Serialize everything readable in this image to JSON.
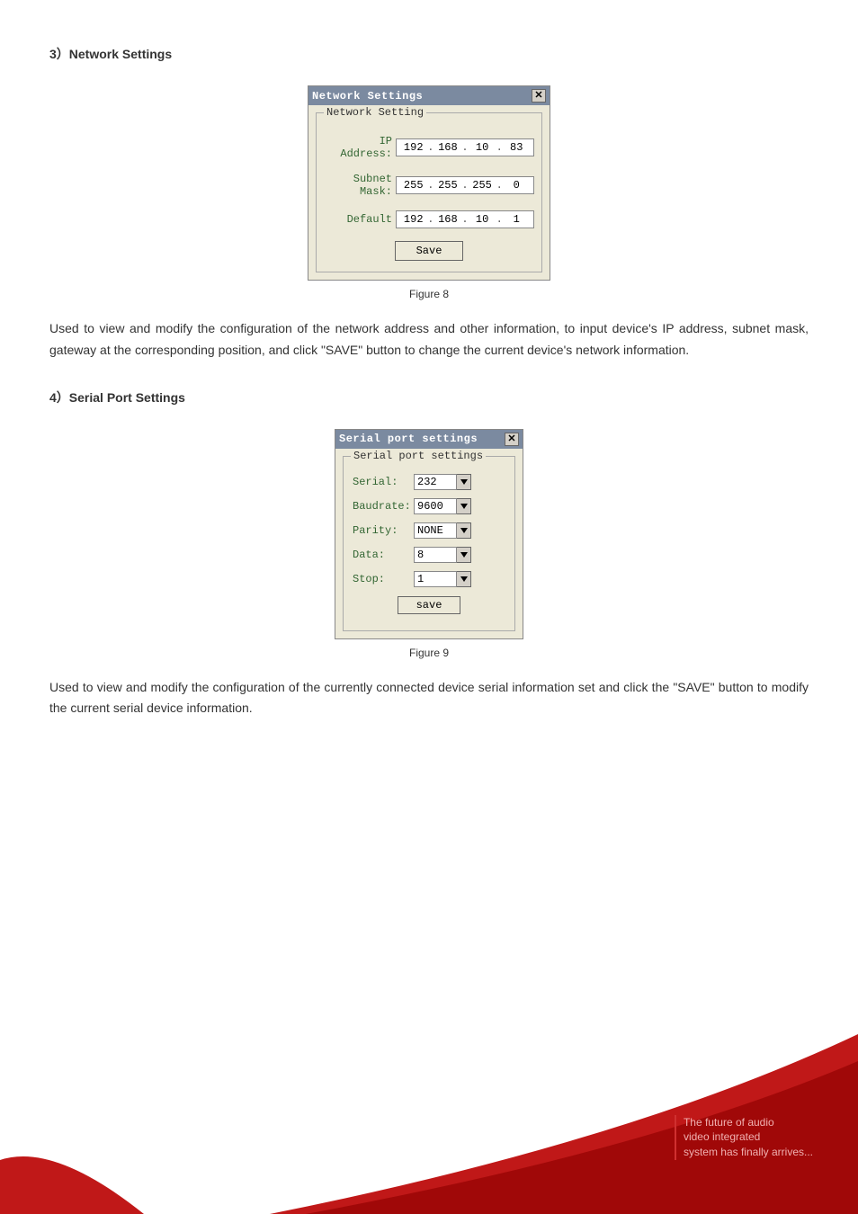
{
  "section3": {
    "title": "3）Network Settings"
  },
  "netDialog": {
    "title": "Network Settings",
    "legend": "Network Setting",
    "ip_label": "IP Address:",
    "ip": [
      "192",
      "168",
      "10",
      "83"
    ],
    "mask_label": "Subnet Mask:",
    "mask": [
      "255",
      "255",
      "255",
      "0"
    ],
    "gw_label": "Default",
    "gw": [
      "192",
      "168",
      "10",
      "1"
    ],
    "save_label": "Save"
  },
  "caption1": "Figure 8",
  "para1": "Used to view and modify the configuration of the network address and other information, to input device's IP address, subnet mask, gateway at the corresponding position, and click \"SAVE\" button to change the current device's network information.",
  "section4": {
    "title": "4）Serial Port Settings"
  },
  "serDialog": {
    "title": "Serial port settings",
    "legend": "Serial port settings",
    "serial_label": "Serial:",
    "serial_value": "232",
    "baud_label": "Baudrate:",
    "baud_value": "9600",
    "parity_label": "Parity:",
    "parity_value": "NONE",
    "data_label": "Data:",
    "data_value": "8",
    "stop_label": "Stop:",
    "stop_value": "1",
    "save_label": "save"
  },
  "caption2": "Figure 9",
  "para2": "Used to view and modify the configuration of the currently connected device serial information set and click the \"SAVE\" button to modify the current serial device information.",
  "footer": {
    "line1": "The future of audio",
    "line2": "video integrated",
    "line3": "system has finally arrives..."
  }
}
